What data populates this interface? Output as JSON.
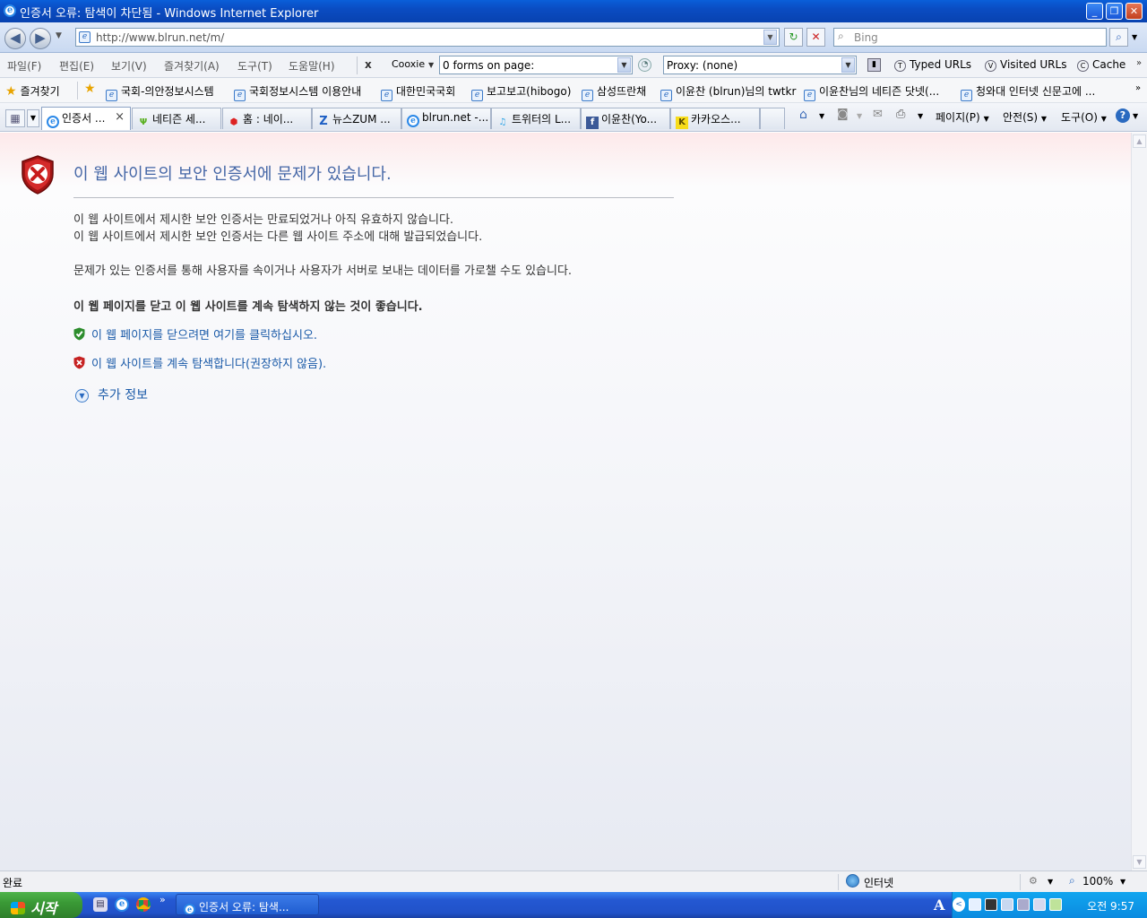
{
  "window": {
    "title": "인증서 오류: 탐색이 차단됨 - Windows Internet Explorer",
    "icon": "ie-icon",
    "minimize": "_",
    "restore": "❐",
    "close": "✕"
  },
  "nav": {
    "back": "◀",
    "forward": "▶",
    "address": "http://www.blrun.net/m/",
    "refresh": "↻",
    "stop": "✕",
    "search_placeholder": "Bing"
  },
  "menu": {
    "items": [
      "파일(F)",
      "편집(E)",
      "보기(V)",
      "즐겨찾기(A)",
      "도구(T)",
      "도움말(H)"
    ],
    "cooxie_close": "x",
    "cooxie": "Cooxie",
    "forms_value": "0 forms on page:",
    "proxy_value": "Proxy: (none)",
    "typed_urls": "Typed URLs",
    "visited_urls": "Visited URLs",
    "cache": "Cache"
  },
  "favorites": {
    "label": "즐겨찾기",
    "items": [
      "국회-의안정보시스템",
      "국회정보시스템 이용안내",
      "대한민국국회",
      "보고보고(hibogo)",
      "삼성뜨란채",
      "이윤찬 (blrun)님의 twtkr",
      "이윤찬님의 네티즌 닷넷(...",
      "청와대 인터넷 신문고에 ..."
    ]
  },
  "tabs": {
    "items": [
      {
        "label": "인증서 ...",
        "close": "×"
      },
      {
        "label": "네티즌 세..."
      },
      {
        "label": "홈 : 네이..."
      },
      {
        "label": "뉴스ZUM ..."
      },
      {
        "label": "blrun.net -..."
      },
      {
        "label": "트위터의 L..."
      },
      {
        "label": "이윤찬(Yo..."
      },
      {
        "label": "카카오스..."
      }
    ],
    "commands": {
      "page": "페이지(P)",
      "safety": "안전(S)",
      "tools": "도구(O)"
    }
  },
  "content": {
    "title": "이 웹 사이트의 보안 인증서에 문제가 있습니다.",
    "line1": "이 웹 사이트에서 제시한 보안 인증서는 만료되었거나 아직 유효하지 않습니다.",
    "line2": "이 웹 사이트에서 제시한 보안 인증서는 다른 웹 사이트 주소에 대해 발급되었습니다.",
    "line3": "문제가 있는 인증서를 통해 사용자를 속이거나 사용자가 서버로 보내는 데이터를 가로챌 수도 있습니다.",
    "recommend": "이 웹 페이지를 닫고 이 웹 사이트를 계속 탐색하지 않는 것이 좋습니다.",
    "close_link": "이 웹 페이지를 닫으려면 여기를 클릭하십시오.",
    "continue_link": "이 웹 사이트를 계속 탐색합니다(권장하지 않음).",
    "more_info": "추가 정보"
  },
  "status": {
    "text": "완료",
    "zone": "인터넷",
    "zoom": "100%"
  },
  "taskbar": {
    "start": "시작",
    "task": "인증서 오류: 탐색...",
    "clock": "오전 9:57",
    "lang": "A"
  }
}
